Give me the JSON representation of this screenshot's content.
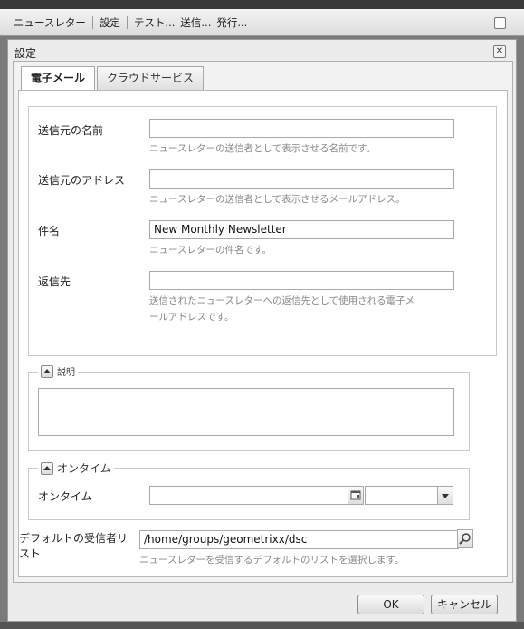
{
  "toolbar": {
    "app_name": "ニュースレター",
    "settings": "設定",
    "test": "テスト...",
    "send": "送信...",
    "publish": "発行..."
  },
  "dialog": {
    "title": "設定",
    "tabs": [
      {
        "label": "電子メール",
        "active": true
      },
      {
        "label": "クラウドサービス",
        "active": false
      }
    ],
    "fields": {
      "sender_name": {
        "label": "送信元の名前",
        "value": "",
        "hint": "ニュースレターの送信者として表示させる名前です。"
      },
      "sender_address": {
        "label": "送信元のアドレス",
        "value": "",
        "hint": "ニュースレターの送信者として表示させるメールアドレス。"
      },
      "subject": {
        "label": "件名",
        "value": "New Monthly Newsletter",
        "hint": "ニュースレターの件名です。"
      },
      "reply_to": {
        "label": "返信先",
        "value": "",
        "hint_line1": "送信されたニュースレターへの返信先として使用される電子メ",
        "hint_line2": "ールアドレスです。"
      }
    },
    "description_section": {
      "legend": "説明",
      "value": ""
    },
    "ontime_section": {
      "legend": "オンタイム",
      "label": "オンタイム",
      "date_value": "",
      "time_value": ""
    },
    "default_list": {
      "label_line1": "デフォルトの受信者リ",
      "label_line2": "スト",
      "value": "/home/groups/geometrixx/dsc",
      "hint": "ニュースレターを受信するデフォルトのリストを選択します。"
    },
    "buttons": {
      "ok": "OK",
      "cancel": "キャンセル"
    }
  }
}
